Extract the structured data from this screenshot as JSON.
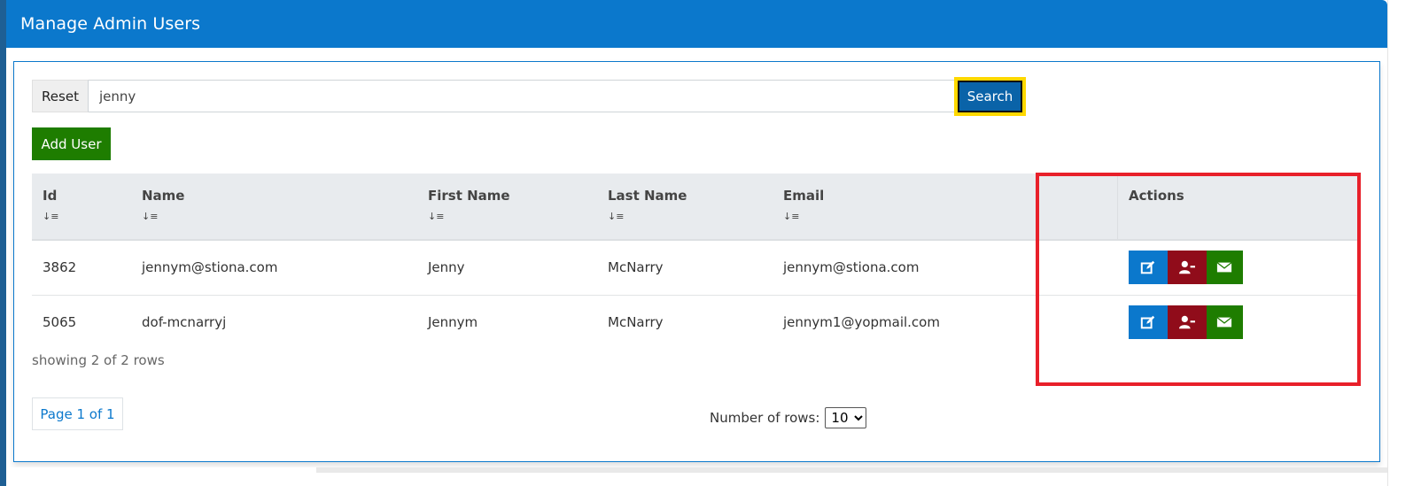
{
  "header": {
    "title": "Manage Admin Users"
  },
  "search": {
    "reset_label": "Reset",
    "query_value": "jenny",
    "search_label": "Search"
  },
  "toolbar": {
    "add_user_label": "Add User"
  },
  "table": {
    "columns": [
      {
        "label": "Id",
        "sortable": true
      },
      {
        "label": "Name",
        "sortable": true
      },
      {
        "label": "First Name",
        "sortable": true
      },
      {
        "label": "Last Name",
        "sortable": true
      },
      {
        "label": "Email",
        "sortable": true
      },
      {
        "label": "",
        "sortable": false
      },
      {
        "label": "Actions",
        "sortable": false
      }
    ],
    "sort_icon": "↓≡",
    "rows": [
      {
        "id": "3862",
        "name": "jennym@stiona.com",
        "first_name": "Jenny",
        "last_name": "McNarry",
        "email": "jennym@stiona.com"
      },
      {
        "id": "5065",
        "name": "dof-mcnarryj",
        "first_name": "Jennym",
        "last_name": "McNarry",
        "email": "jennym1@yopmail.com"
      }
    ],
    "actions": [
      {
        "name": "edit",
        "icon": "edit-icon",
        "color": "#0b78cc"
      },
      {
        "name": "remove-user",
        "icon": "user-minus-icon",
        "color": "#900c1a"
      },
      {
        "name": "email",
        "icon": "envelope-icon",
        "color": "#1e7d00"
      }
    ]
  },
  "footer": {
    "row_count_text": "showing 2 of 2 rows",
    "pager_text": "Page 1 of 1",
    "rows_label": "Number of rows:",
    "rows_selected": "10"
  },
  "colors": {
    "header_bg": "#0b78cc",
    "primary": "#0b78cc",
    "success": "#1e7d00",
    "danger": "#900c1a",
    "focus_ring": "#ffd800",
    "annotation_box": "#e8202a"
  }
}
